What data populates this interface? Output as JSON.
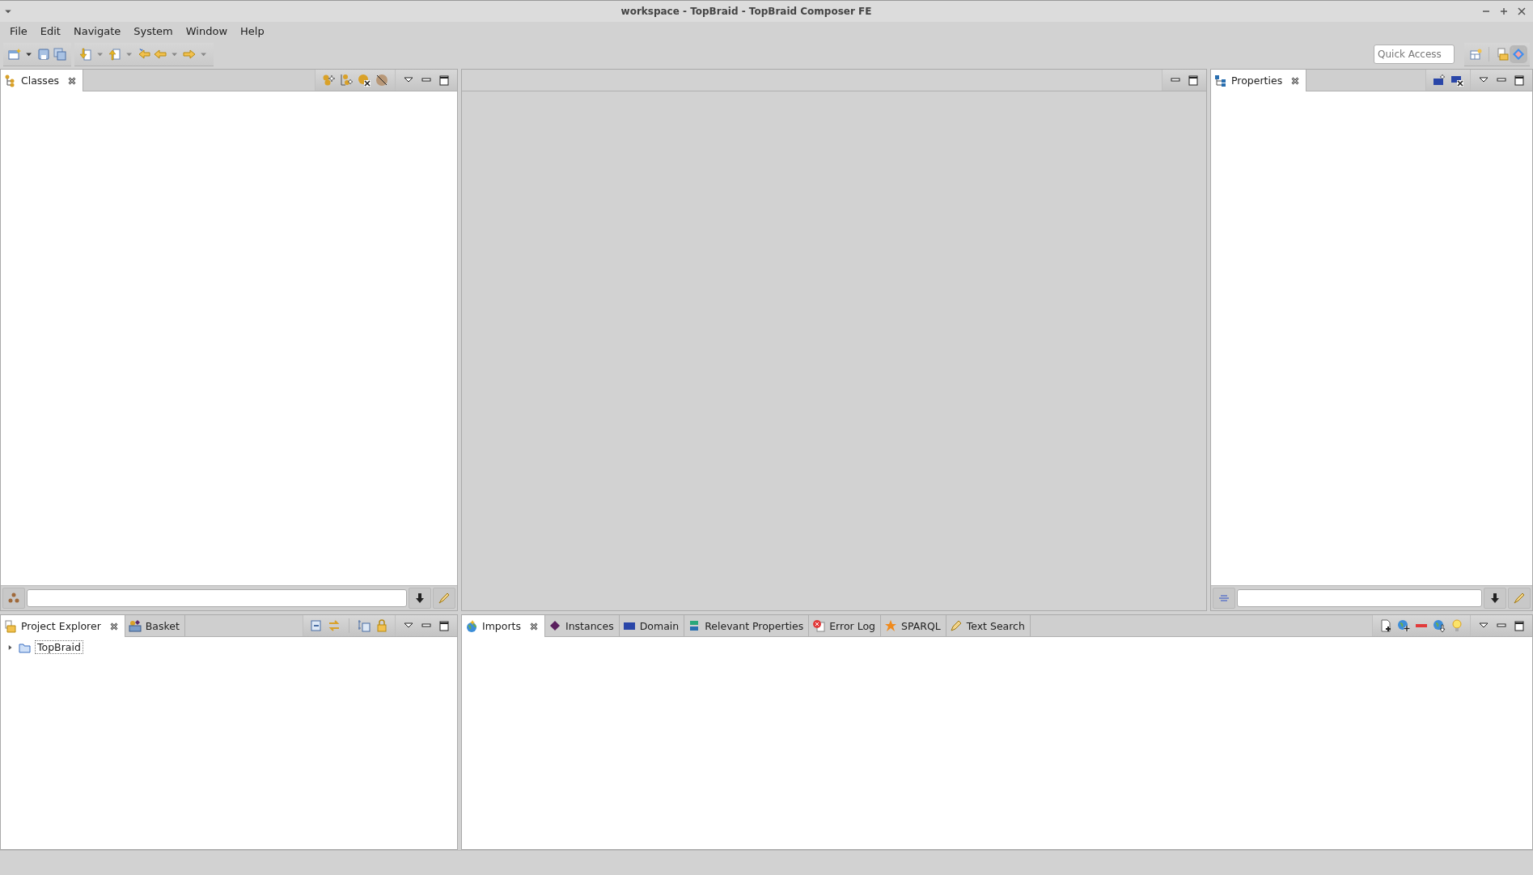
{
  "window": {
    "title": "workspace - TopBraid - TopBraid Composer FE"
  },
  "menu": [
    {
      "label": "File"
    },
    {
      "label": "Edit"
    },
    {
      "label": "Navigate"
    },
    {
      "label": "System"
    },
    {
      "label": "Window"
    },
    {
      "label": "Help"
    }
  ],
  "quick_access": {
    "placeholder": "Quick Access"
  },
  "classes_view": {
    "tabs": [
      {
        "label": "Classes",
        "kind": "classes",
        "selected": true
      }
    ]
  },
  "properties_view": {
    "tabs": [
      {
        "label": "Properties",
        "kind": "properties",
        "selected": true
      }
    ]
  },
  "explorer_view": {
    "tabs": [
      {
        "label": "Project Explorer",
        "kind": "explorer",
        "selected": true
      },
      {
        "label": "Basket",
        "kind": "basket",
        "selected": false
      }
    ],
    "tree": [
      {
        "label": "TopBraid",
        "expanded": false,
        "focused": true
      }
    ]
  },
  "info_view": {
    "tabs": [
      {
        "label": "Imports",
        "kind": "imports",
        "selected": true
      },
      {
        "label": "Instances",
        "kind": "instances",
        "selected": false
      },
      {
        "label": "Domain",
        "kind": "domain",
        "selected": false
      },
      {
        "label": "Relevant Properties",
        "kind": "relprops",
        "selected": false
      },
      {
        "label": "Error Log",
        "kind": "errorlog",
        "selected": false
      },
      {
        "label": "SPARQL",
        "kind": "sparql",
        "selected": false
      },
      {
        "label": "Text Search",
        "kind": "textsearch",
        "selected": false
      }
    ]
  }
}
